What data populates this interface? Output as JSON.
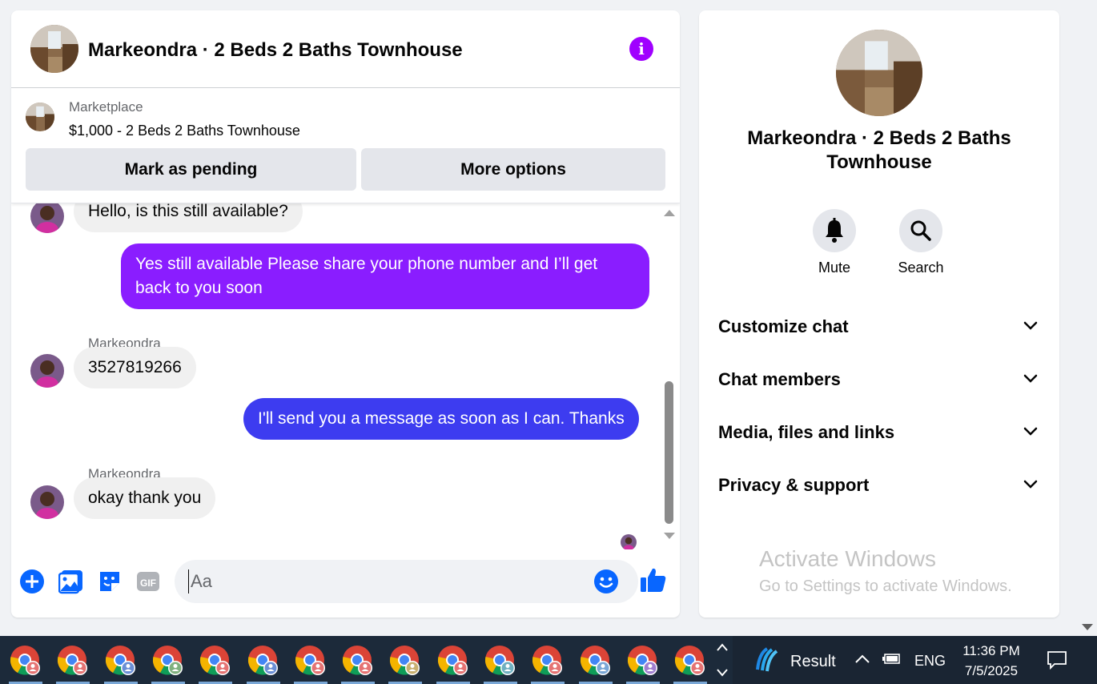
{
  "colors": {
    "accent_purple": "#a000ff",
    "bubble_purple": "#8a1dff",
    "bubble_blue": "#3d3cf0",
    "messenger_blue": "#0866ff"
  },
  "header": {
    "title": "Markeondra · 2 Beds 2 Baths Townhouse",
    "info_icon": "i"
  },
  "marketplace": {
    "label": "Marketplace",
    "listing": "$1,000 - 2 Beds 2 Baths Townhouse",
    "mark_pending": "Mark as pending",
    "more_options": "More options"
  },
  "messages": [
    {
      "from": "them",
      "text": "Hello, is this still available?"
    },
    {
      "from": "me",
      "text_line1": "Yes still available Please share your phone number and I’ll get",
      "text_line2": "back to you soon"
    },
    {
      "from": "them",
      "sender": "Markeondra",
      "text": "3527819266"
    },
    {
      "from": "me",
      "text": "I'll send you a message as soon as I can. Thanks"
    },
    {
      "from": "them",
      "sender": "Markeondra",
      "text": "okay thank you"
    }
  ],
  "composer": {
    "placeholder": "Aa",
    "gif_label": "GIF"
  },
  "info_panel": {
    "title": "Markeondra · 2 Beds 2 Baths Townhouse",
    "mute": "Mute",
    "search": "Search",
    "sections": [
      "Customize chat",
      "Chat members",
      "Media, files and links",
      "Privacy & support"
    ]
  },
  "watermark": {
    "line1": "Activate Windows",
    "line2": "Go to Settings to activate Windows."
  },
  "taskbar": {
    "apps_count_label": "chrome-profiles",
    "tray_app": "Result",
    "language": "ENG",
    "time": "11:36 PM",
    "date": "7/5/2025"
  }
}
